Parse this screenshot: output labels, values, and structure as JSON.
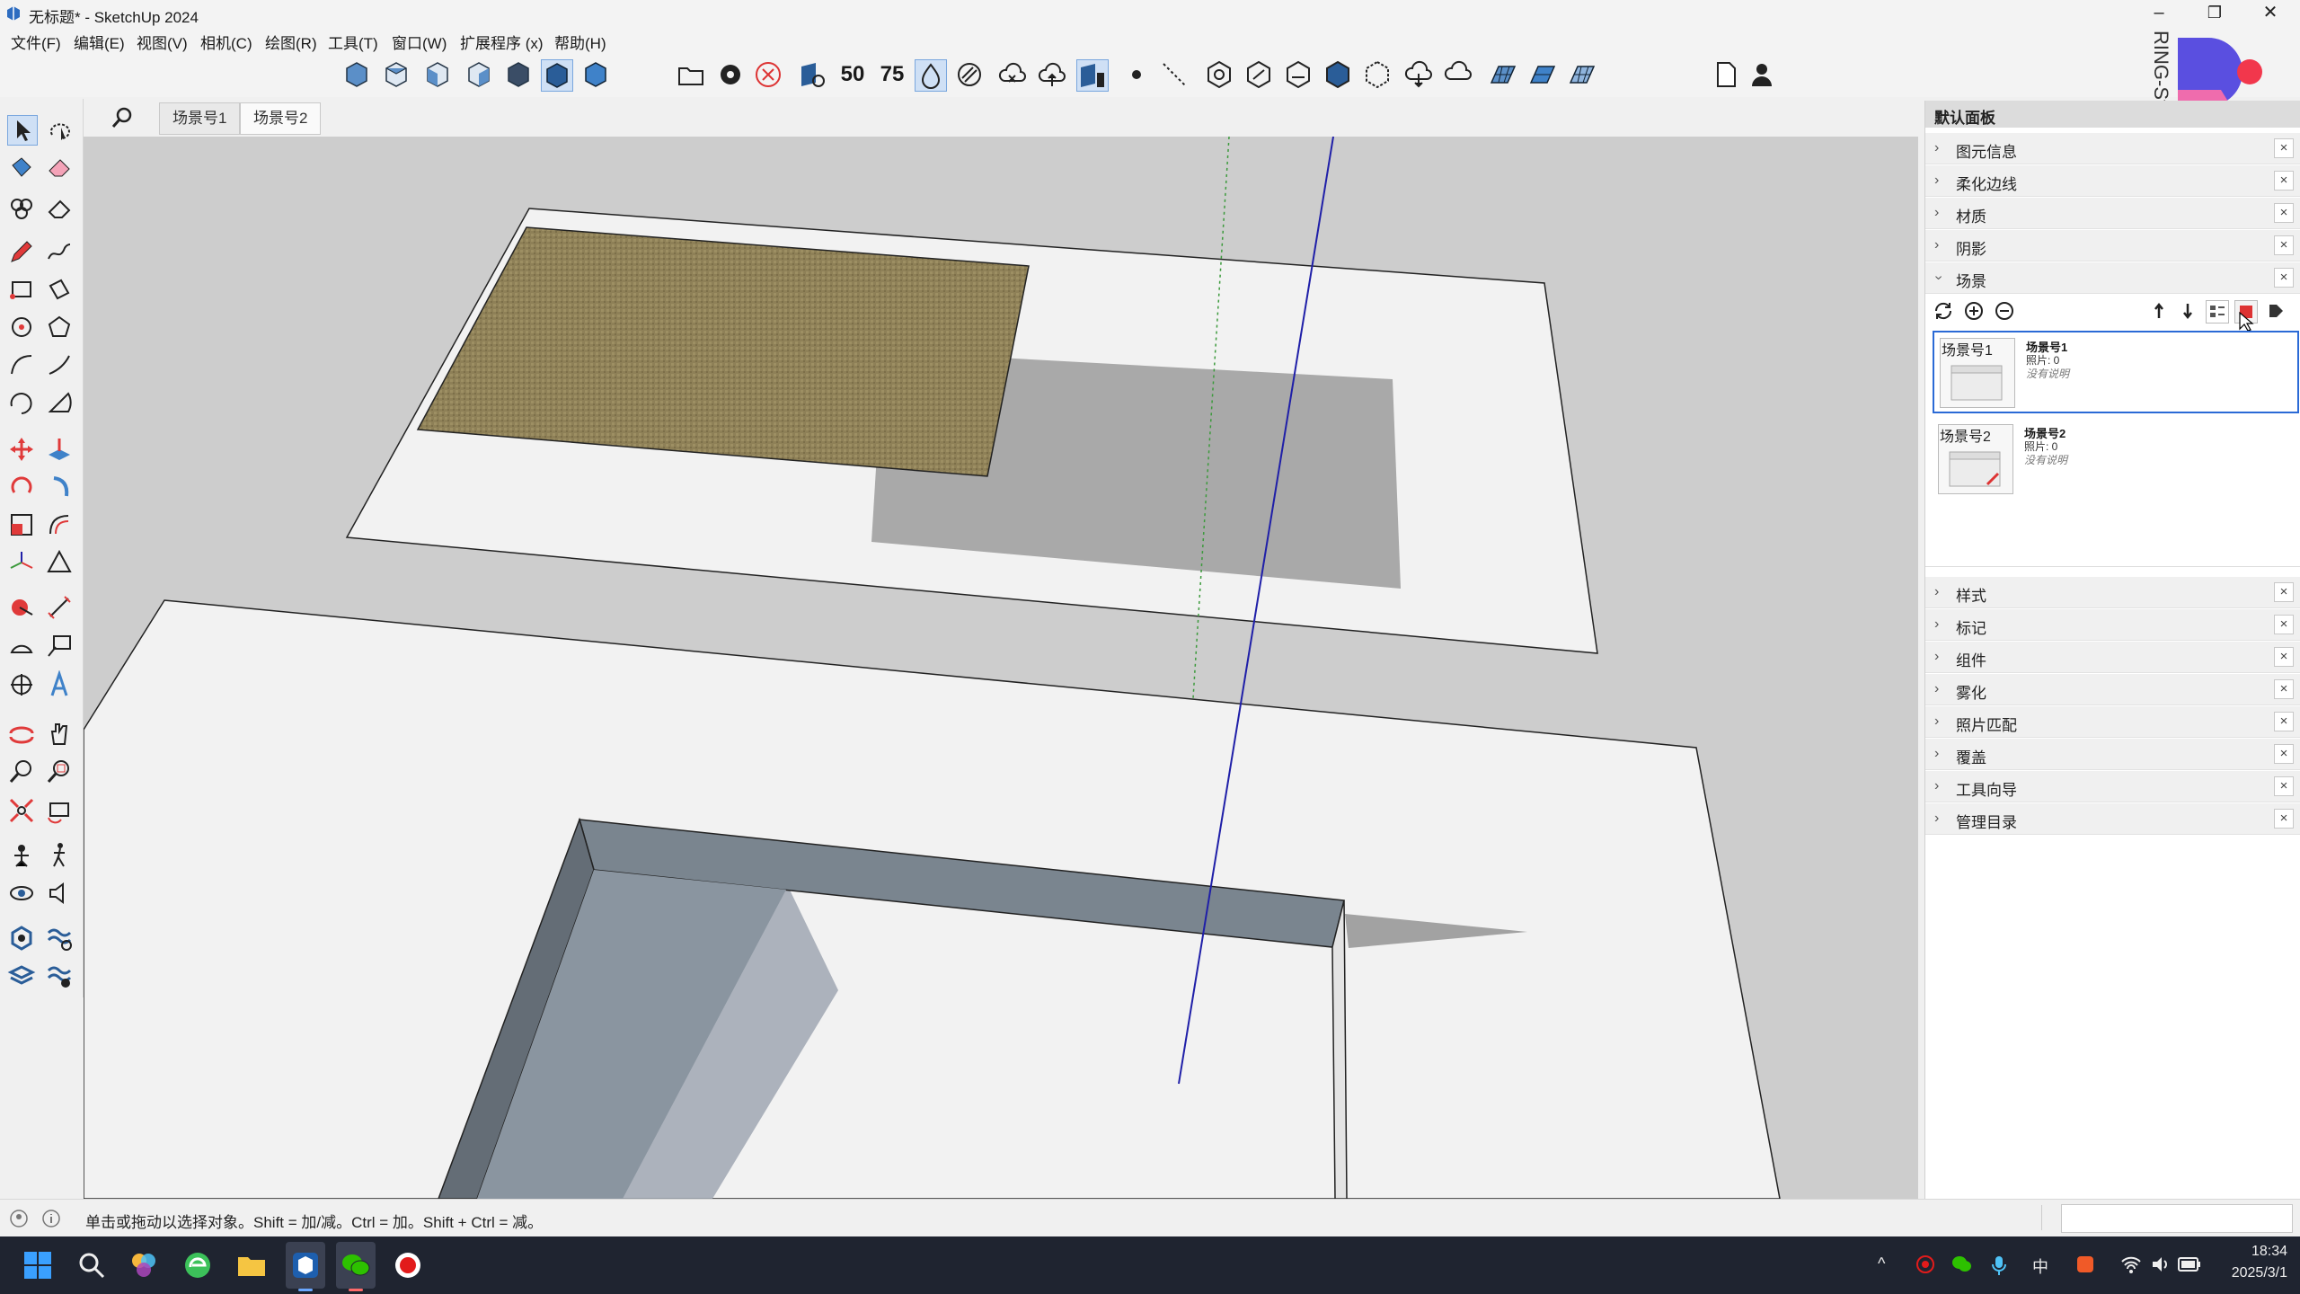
{
  "window": {
    "title": "无标题* - SketchUp 2024",
    "minimize": "–",
    "restore": "❐",
    "close": "✕"
  },
  "menu": [
    "文件(F)",
    "编辑(E)",
    "视图(V)",
    "相机(C)",
    "绘图(R)",
    "工具(T)",
    "窗口(W)",
    "扩展程序 (x)",
    "帮助(H)"
  ],
  "toolbar": {
    "speed_a": "50",
    "speed_b": "75"
  },
  "scene_tabs": [
    "场景号1",
    "场景号2"
  ],
  "panel": {
    "title": "默认面板",
    "sections_top": [
      "图元信息",
      "柔化边线",
      "材质",
      "阴影"
    ],
    "scenes_section": "场景",
    "scenes": [
      {
        "thumb_label": "场景号1",
        "name": "场景号1",
        "sub": "照片: 0",
        "desc": "没有说明"
      },
      {
        "thumb_label": "场景号2",
        "name": "场景号2",
        "sub": "照片: 0",
        "desc": "没有说明"
      }
    ],
    "sections_bottom": [
      "样式",
      "标记",
      "组件",
      "雾化",
      "照片匹配",
      "覆盖",
      "工具向导",
      "管理目录"
    ],
    "close_glyph": "×"
  },
  "watermark": "RING-Studio",
  "status": {
    "hint": "单击或拖动以选择对象。Shift = 加/减。Ctrl = 加。Shift + Ctrl = 减。"
  },
  "taskbar": {
    "ime": "中",
    "time": "18:34",
    "date": "2025/3/1"
  },
  "colors": {
    "accent": "#2b6ad6",
    "axis_blue": "#1f1fa8",
    "axis_green": "#3c9a3c",
    "ground": "#f2f2f2",
    "sky": "#cdcdcd",
    "shadow": "#a9a9a9",
    "texture": "#8c7e55",
    "taskbar": "#1f2430"
  }
}
